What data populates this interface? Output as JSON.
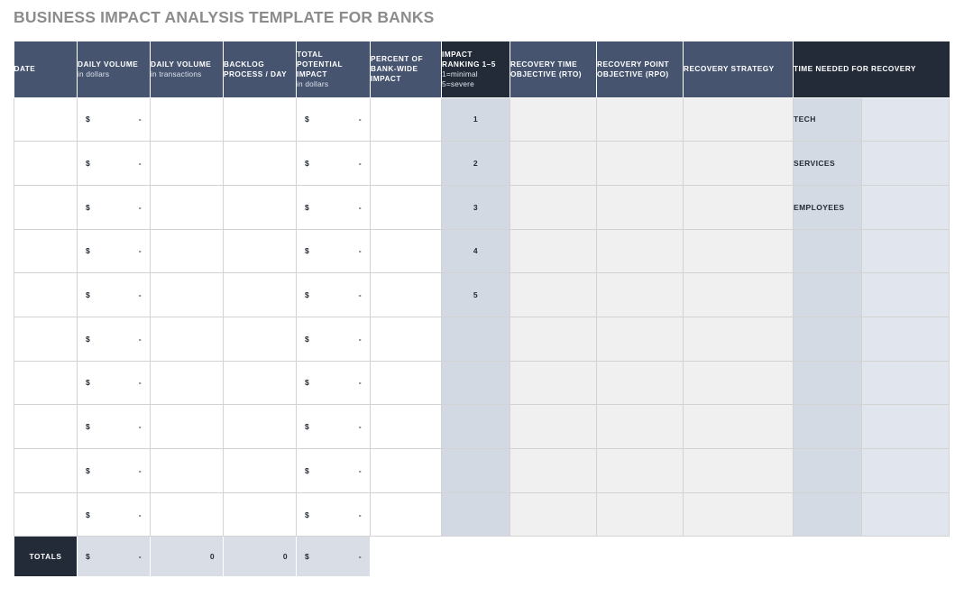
{
  "page": {
    "title": "BUSINESS IMPACT ANALYSIS TEMPLATE FOR BANKS",
    "title_color": "#8c8c8c",
    "header_color": "#465470",
    "header_accent_color": "#232b38",
    "rank_column_color": "#d3d9e3",
    "soft_column_color": "#f0f0f0"
  },
  "table": {
    "columns": [
      {
        "key": "date",
        "label": "DATE",
        "sub": "",
        "style": "normal",
        "align": "left",
        "width": 70
      },
      {
        "key": "daily_volume_dollars",
        "label": "DAILY VOLUME",
        "sub": "in dollars",
        "style": "normal",
        "align": "left",
        "width": 81
      },
      {
        "key": "daily_volume_transactions",
        "label": "DAILY VOLUME",
        "sub": "in transactions",
        "style": "normal",
        "align": "left",
        "width": 81
      },
      {
        "key": "backlog_process_day",
        "label": "BACKLOG PROCESS / DAY",
        "sub": "",
        "style": "normal",
        "align": "left",
        "width": 81
      },
      {
        "key": "total_potential_impact",
        "label": "TOTAL POTENTIAL IMPACT",
        "sub": "in dollars",
        "style": "normal",
        "align": "left",
        "width": 82
      },
      {
        "key": "percent_of_bank_wide_impact",
        "label": "PERCENT OF BANK-WIDE IMPACT",
        "sub": "",
        "style": "normal",
        "align": "left",
        "width": 79
      },
      {
        "key": "impact_ranking",
        "label": "IMPACT RANKING 1-5",
        "sub": "1=minimal 5=severe",
        "style": "dark",
        "align": "left",
        "width": 76
      },
      {
        "key": "recovery_time_objective",
        "label": "RECOVERY TIME OBJECTIVE (RTO)",
        "sub": "",
        "style": "normal",
        "align": "left",
        "width": 96
      },
      {
        "key": "recovery_point_objective",
        "label": "RECOVERY POINT OBJECTIVE (RPO)",
        "sub": "",
        "style": "normal",
        "align": "left",
        "width": 96
      },
      {
        "key": "recovery_strategy",
        "label": "RECOVERY STRATEGY",
        "sub": "",
        "style": "normal",
        "align": "left",
        "width": 122
      },
      {
        "key": "time_needed_for_recovery",
        "label": "TIME NEEDED FOR RECOVERY",
        "sub": "",
        "style": "dark",
        "align": "left",
        "width": 173
      }
    ],
    "header_labels": {
      "date": "DATE",
      "daily_volume_dollars_main": "DAILY VOLUME",
      "daily_volume_dollars_sub": "in dollars",
      "daily_volume_transactions_main": "DAILY VOLUME",
      "daily_volume_transactions_sub": "in transactions",
      "backlog_line1": "BACKLOG",
      "backlog_line2": "PROCESS / DAY",
      "total_potential_line1": "TOTAL",
      "total_potential_line2": "POTENTIAL",
      "total_potential_line3": "IMPACT",
      "total_potential_sub": "in dollars",
      "percent_line1": "PERCENT OF",
      "percent_line2": "BANK-WIDE",
      "percent_line3": "IMPACT",
      "impact_line1": "IMPACT",
      "impact_line2": "RANKING 1–5",
      "impact_sub1": "1=minimal",
      "impact_sub2": "5=severe",
      "rto_line1": "RECOVERY TIME",
      "rto_line2": "OBJECTIVE (RTO)",
      "rpo_line1": "RECOVERY POINT",
      "rpo_line2": "OBJECTIVE (RPO)",
      "recovery_strategy": "RECOVERY STRATEGY",
      "time_needed": "TIME NEEDED FOR RECOVERY"
    },
    "currency_symbol": "$",
    "empty_value": "-",
    "rows": [
      {
        "date": "",
        "daily_volume_dollars": "-",
        "daily_volume_transactions": "",
        "backlog_process_day": "",
        "total_potential_impact": "-",
        "percent_of_bank_wide_impact": "",
        "impact_ranking": "1",
        "recovery_time_objective": "",
        "recovery_point_objective": "",
        "recovery_strategy": "",
        "recovery_category": "TECH",
        "time_needed_for_recovery": ""
      },
      {
        "date": "",
        "daily_volume_dollars": "-",
        "daily_volume_transactions": "",
        "backlog_process_day": "",
        "total_potential_impact": "-",
        "percent_of_bank_wide_impact": "",
        "impact_ranking": "2",
        "recovery_time_objective": "",
        "recovery_point_objective": "",
        "recovery_strategy": "",
        "recovery_category": "SERVICES",
        "time_needed_for_recovery": ""
      },
      {
        "date": "",
        "daily_volume_dollars": "-",
        "daily_volume_transactions": "",
        "backlog_process_day": "",
        "total_potential_impact": "-",
        "percent_of_bank_wide_impact": "",
        "impact_ranking": "3",
        "recovery_time_objective": "",
        "recovery_point_objective": "",
        "recovery_strategy": "",
        "recovery_category": "EMPLOYEES",
        "time_needed_for_recovery": ""
      },
      {
        "date": "",
        "daily_volume_dollars": "-",
        "daily_volume_transactions": "",
        "backlog_process_day": "",
        "total_potential_impact": "-",
        "percent_of_bank_wide_impact": "",
        "impact_ranking": "4",
        "recovery_time_objective": "",
        "recovery_point_objective": "",
        "recovery_strategy": "",
        "recovery_category": "",
        "time_needed_for_recovery": ""
      },
      {
        "date": "",
        "daily_volume_dollars": "-",
        "daily_volume_transactions": "",
        "backlog_process_day": "",
        "total_potential_impact": "-",
        "percent_of_bank_wide_impact": "",
        "impact_ranking": "5",
        "recovery_time_objective": "",
        "recovery_point_objective": "",
        "recovery_strategy": "",
        "recovery_category": "",
        "time_needed_for_recovery": ""
      },
      {
        "date": "",
        "daily_volume_dollars": "-",
        "daily_volume_transactions": "",
        "backlog_process_day": "",
        "total_potential_impact": "-",
        "percent_of_bank_wide_impact": "",
        "impact_ranking": "",
        "recovery_time_objective": "",
        "recovery_point_objective": "",
        "recovery_strategy": "",
        "recovery_category": "",
        "time_needed_for_recovery": ""
      },
      {
        "date": "",
        "daily_volume_dollars": "-",
        "daily_volume_transactions": "",
        "backlog_process_day": "",
        "total_potential_impact": "-",
        "percent_of_bank_wide_impact": "",
        "impact_ranking": "",
        "recovery_time_objective": "",
        "recovery_point_objective": "",
        "recovery_strategy": "",
        "recovery_category": "",
        "time_needed_for_recovery": ""
      },
      {
        "date": "",
        "daily_volume_dollars": "-",
        "daily_volume_transactions": "",
        "backlog_process_day": "",
        "total_potential_impact": "-",
        "percent_of_bank_wide_impact": "",
        "impact_ranking": "",
        "recovery_time_objective": "",
        "recovery_point_objective": "",
        "recovery_strategy": "",
        "recovery_category": "",
        "time_needed_for_recovery": ""
      },
      {
        "date": "",
        "daily_volume_dollars": "-",
        "daily_volume_transactions": "",
        "backlog_process_day": "",
        "total_potential_impact": "-",
        "percent_of_bank_wide_impact": "",
        "impact_ranking": "",
        "recovery_time_objective": "",
        "recovery_point_objective": "",
        "recovery_strategy": "",
        "recovery_category": "",
        "time_needed_for_recovery": ""
      },
      {
        "date": "",
        "daily_volume_dollars": "-",
        "daily_volume_transactions": "",
        "backlog_process_day": "",
        "total_potential_impact": "-",
        "percent_of_bank_wide_impact": "",
        "impact_ranking": "",
        "recovery_time_objective": "",
        "recovery_point_objective": "",
        "recovery_strategy": "",
        "recovery_category": "",
        "time_needed_for_recovery": ""
      }
    ],
    "totals": {
      "label": "TOTALS",
      "daily_volume_dollars": "-",
      "daily_volume_transactions": "0",
      "backlog_process_day": "0",
      "total_potential_impact": "-"
    }
  }
}
